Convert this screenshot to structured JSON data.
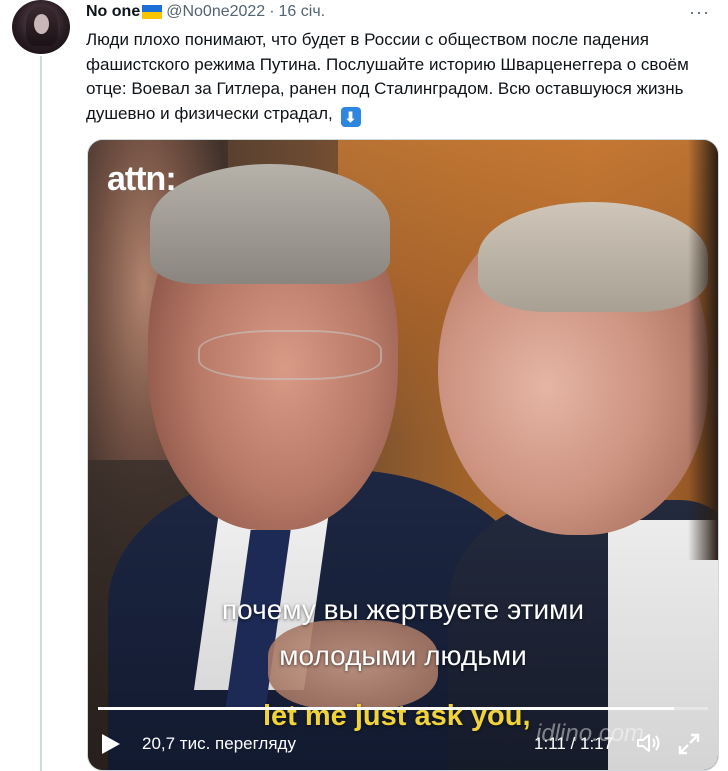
{
  "tweet": {
    "author_name": "No one",
    "handle": "@No0ne2022",
    "separator": "·",
    "time": "16 січ.",
    "more_label": "···",
    "text": "Люди плохо понимают, что будет в России с обществом после падения фашистского режима Путина. Послушайте историю Шварценеггера о своём отце: Воевал за Гитлера, ранен под Сталинградом. Всю оставшуюся жизнь душевно и физически страдал,",
    "emoji_arrow": "⬇"
  },
  "video": {
    "logo_text": "attn:",
    "caption_ru_line1": "почему вы жертвуете этими",
    "caption_ru_line2": "молодыми людьми",
    "caption_en": "let me just ask you,",
    "watermark": "idlino.com",
    "views": "20,7 тис. перегляду",
    "current_time": "1:11",
    "duration": "1:17",
    "time_separator": " / ",
    "progress_fraction": 0.944
  },
  "colors": {
    "flag_blue": "#1d6fd8",
    "flag_yellow": "#f6c400",
    "caption_en": "#f0d23a",
    "secondary_text": "#536471"
  },
  "icons": [
    "play-icon",
    "volume-icon",
    "fullscreen-icon",
    "down-arrow-emoji",
    "ukraine-flag-icon"
  ]
}
